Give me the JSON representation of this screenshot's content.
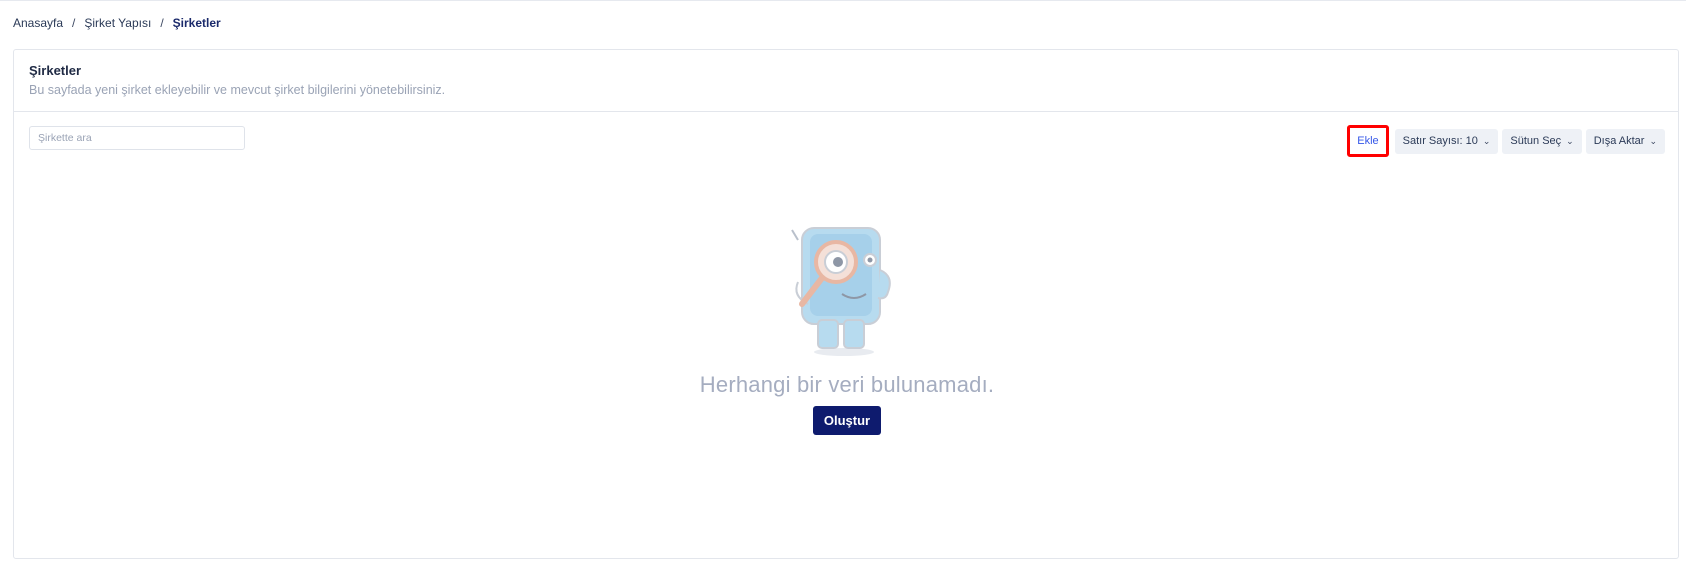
{
  "breadcrumb": {
    "items": [
      "Anasayfa",
      "Şirket Yapısı",
      "Şirketler"
    ],
    "separator": "/"
  },
  "card": {
    "title": "Şirketler",
    "subtitle": "Bu sayfada yeni şirket ekleyebilir ve mevcut şirket bilgilerini yönetebilirsiniz."
  },
  "toolbar": {
    "search_placeholder": "Şirkette ara",
    "search_value": "",
    "add_label": "Ekle",
    "rows_label": "Satır Sayısı: 10",
    "columns_label": "Sütun Seç",
    "export_label": "Dışa Aktar"
  },
  "empty_state": {
    "message": "Herhangi bir veri bulunamadı.",
    "create_label": "Oluştur",
    "illustration_icon": "magnifier-mascot-icon"
  },
  "colors": {
    "accent_dark": "#0e1b6e",
    "add_text": "#3557e8",
    "highlight_box": "#ff0000",
    "muted_text": "#9aa3b5"
  }
}
